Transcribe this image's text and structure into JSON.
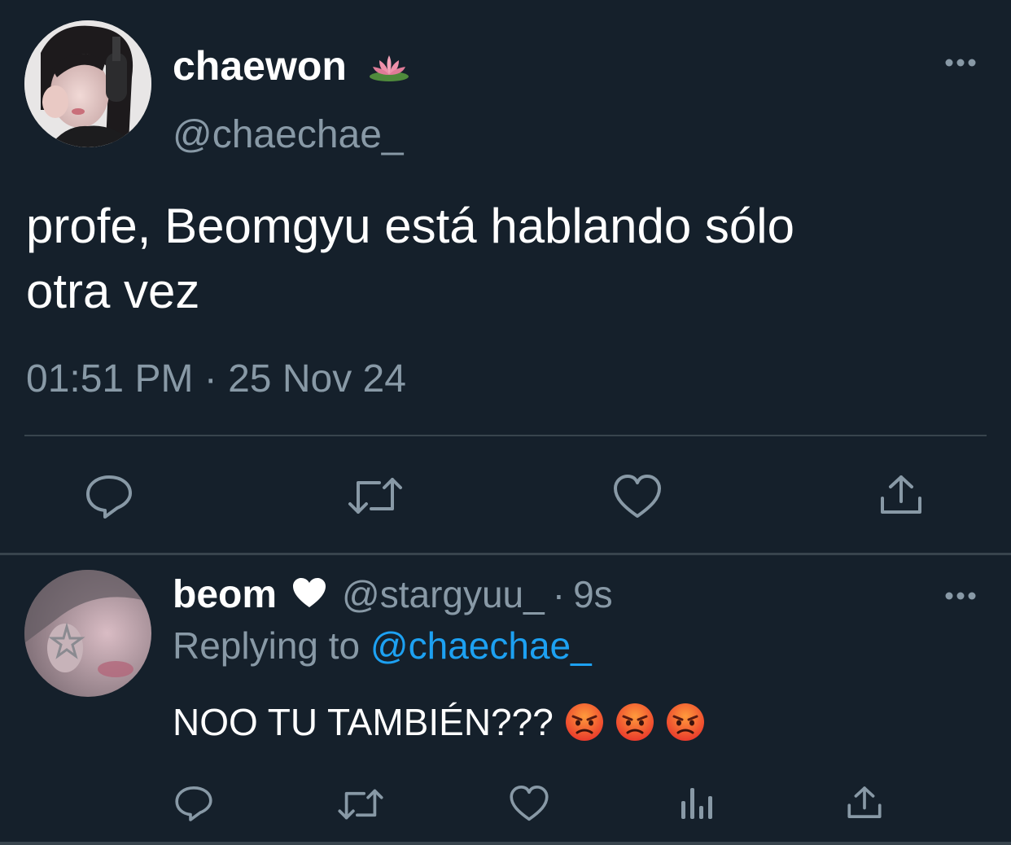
{
  "tweet": {
    "author": {
      "display_name": "chaewon",
      "name_emoji": "lotus-icon",
      "handle": "@chaechae_"
    },
    "text_line1": "profe, Beomgyu está hablando sólo",
    "text_line2": "otra vez",
    "timestamp": "01:51 PM · 25 Nov 24",
    "actions": [
      "reply-icon",
      "retweet-icon",
      "like-icon",
      "share-icon"
    ]
  },
  "reply": {
    "author": {
      "display_name": "beom",
      "name_emoji": "white-heart-icon",
      "handle": "@stargyuu_",
      "separator": "·",
      "time": "9s"
    },
    "replying_prefix": "Replying to ",
    "replying_mention": "@chaechae_",
    "text": "NOO TU TAMBIÉN???",
    "emojis": [
      "angry-face-icon",
      "angry-face-icon",
      "angry-face-icon"
    ],
    "actions": [
      "reply-icon",
      "retweet-icon",
      "like-icon",
      "analytics-icon",
      "share-icon"
    ]
  },
  "colors": {
    "background": "#15202b",
    "text_primary": "#ffffff",
    "text_secondary": "#8899a6",
    "link": "#1da1f2",
    "divider": "#38444d"
  }
}
